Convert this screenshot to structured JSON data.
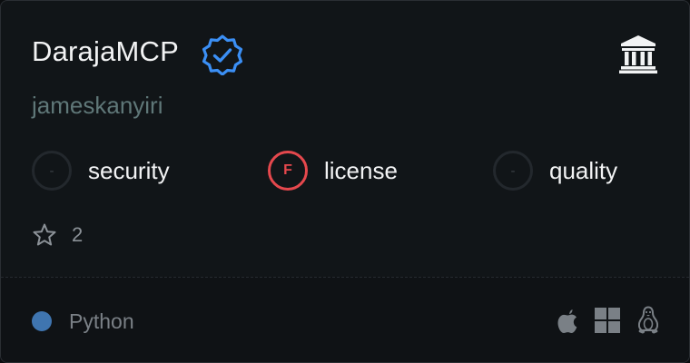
{
  "server": {
    "name": "DarajaMCP",
    "owner": "jameskanyiri",
    "verified": true
  },
  "scores": [
    {
      "grade": "-",
      "label": "security"
    },
    {
      "grade": "F",
      "label": "license"
    },
    {
      "grade": "-",
      "label": "quality"
    }
  ],
  "stars": "2",
  "footer": {
    "language": "Python",
    "language_color": "#3f75b0",
    "platforms": [
      "apple-icon",
      "windows-icon",
      "linux-icon"
    ]
  },
  "colors": {
    "verified": "#3b8ff5",
    "fail": "#e5484d"
  }
}
